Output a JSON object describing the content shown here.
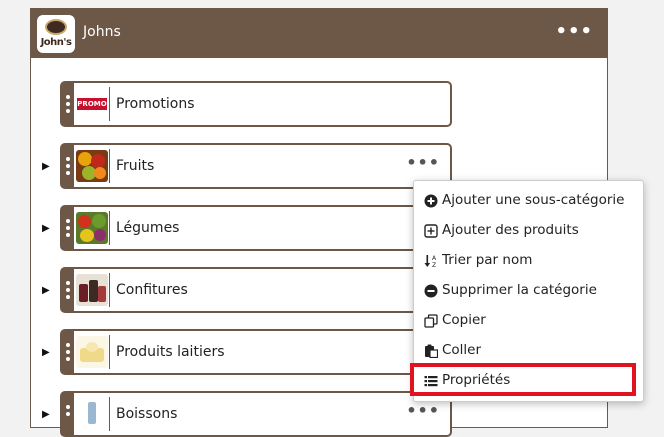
{
  "header": {
    "title": "Johns",
    "logo_text": "John's",
    "menu_icon": "ellipsis-icon"
  },
  "categories": [
    {
      "label": "Promotions",
      "thumb": "promo",
      "has_children": false,
      "thumb_text": "PROMO"
    },
    {
      "label": "Fruits",
      "thumb": "fruits",
      "has_children": true
    },
    {
      "label": "Légumes",
      "thumb": "vegetables",
      "has_children": true
    },
    {
      "label": "Confitures",
      "thumb": "jams",
      "has_children": true
    },
    {
      "label": "Produits laitiers",
      "thumb": "dairy",
      "has_children": true
    },
    {
      "label": "Boissons",
      "thumb": "drinks",
      "has_children": true
    }
  ],
  "context_menu": {
    "items": [
      {
        "label": "Ajouter une sous-catégorie",
        "icon": "plus-circle-icon"
      },
      {
        "label": "Ajouter des produits",
        "icon": "plus-square-icon"
      },
      {
        "label": "Trier par nom",
        "icon": "sort-alpha-icon"
      },
      {
        "label": "Supprimer la catégorie",
        "icon": "minus-circle-icon"
      },
      {
        "label": "Copier",
        "icon": "copy-icon"
      },
      {
        "label": "Coller",
        "icon": "paste-icon"
      },
      {
        "label": "Propriétés",
        "icon": "list-icon",
        "highlighted": true
      }
    ]
  },
  "colors": {
    "brand": "#6d5848",
    "highlight": "#e0141e"
  }
}
